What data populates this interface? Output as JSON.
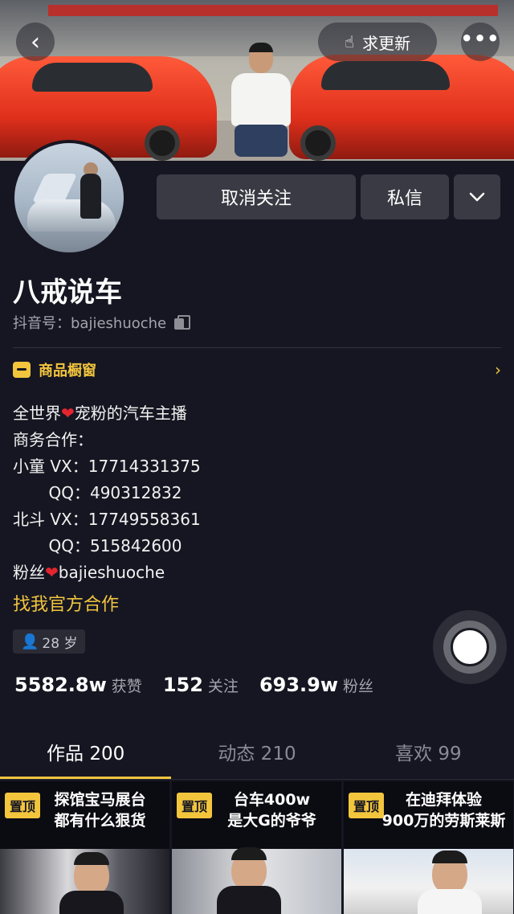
{
  "header": {
    "back_icon": "chevron-left-icon",
    "update_icon": "hand-point-icon",
    "update_label": "求更新",
    "more_icon": "ellipsis-icon"
  },
  "actions": {
    "unfollow_label": "取消关注",
    "message_label": "私信",
    "expand_icon": "chevron-down-icon"
  },
  "profile": {
    "name": "八戒说车",
    "douyin_id": "抖音号：bajieshuoche",
    "copy_icon": "copy-icon"
  },
  "shop": {
    "label": "商品橱窗",
    "arrow": "›"
  },
  "bio": {
    "line1_before": "全世界",
    "line1_heart": "❤",
    "line1_after": "宠粉的汽车主播",
    "line2": "商务合作：",
    "line3": "小童 VX：17714331375",
    "line4": "       QQ：490312832",
    "line5": "北斗 VX：17749558361",
    "line6": "       QQ：515842600",
    "line7_before": "粉丝",
    "line7_heart": "❤",
    "line7_after": "bajieshuoche"
  },
  "official_link": "找我官方合作",
  "age_tag": "28 岁",
  "stats": {
    "likes_num": "5582.8w",
    "likes_label": "获赞",
    "following_num": "152",
    "following_label": "关注",
    "followers_num": "693.9w",
    "followers_label": "粉丝"
  },
  "tabs": [
    {
      "label": "作品 200",
      "active": true
    },
    {
      "label": "动态 210",
      "active": false
    },
    {
      "label": "喜欢 99",
      "active": false
    }
  ],
  "videos": [
    {
      "pin": "置顶",
      "title_line1": "探馆宝马展台",
      "title_line2": "都有什么狠货"
    },
    {
      "pin": "置顶",
      "title_line1": "台车400w",
      "title_line2": "是大G的爷爷"
    },
    {
      "pin": "置顶",
      "title_line1": "在迪拜体验",
      "title_line2": "900万的劳斯莱斯"
    }
  ],
  "colors": {
    "background": "#161622",
    "accent": "#f2c53d",
    "button": "#3a3a44"
  }
}
